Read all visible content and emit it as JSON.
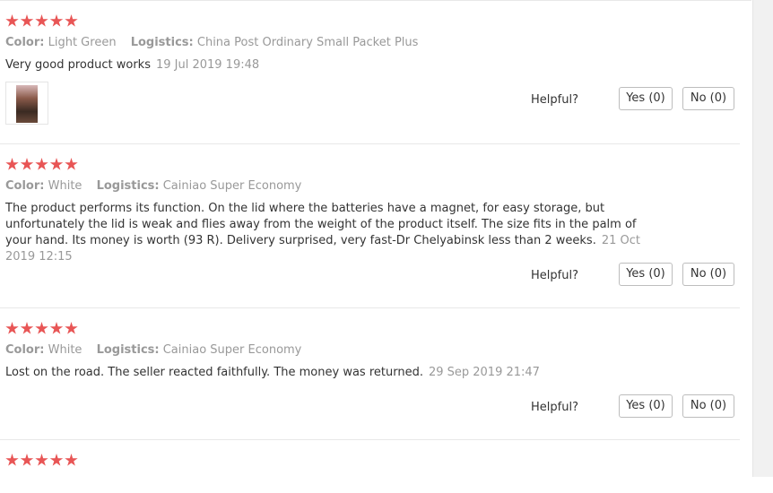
{
  "reviews": [
    {
      "color_label": "Color:",
      "color_value": "Light Green",
      "logistics_label": "Logistics:",
      "logistics_value": "China Post Ordinary Small Packet Plus",
      "text": "Very good product works",
      "date": "19 Jul 2019 19:48",
      "has_photo": true,
      "helpful_label": "Helpful?",
      "yes_label": "Yes (0)",
      "no_label": "No (0)"
    },
    {
      "color_label": "Color:",
      "color_value": "White",
      "logistics_label": "Logistics:",
      "logistics_value": "Cainiao Super Economy",
      "text": "The product performs its function. On the lid where the batteries have a magnet, for easy storage, but unfortunately the lid is weak and flies away from the weight of the product itself. The size fits in the palm of your hand. Its money is worth (93 R). Delivery surprised, very fast-Dr Chelyabinsk less than 2 weeks.",
      "date": "21 Oct 2019 12:15",
      "has_photo": false,
      "helpful_label": "Helpful?",
      "yes_label": "Yes (0)",
      "no_label": "No (0)"
    },
    {
      "color_label": "Color:",
      "color_value": "White",
      "logistics_label": "Logistics:",
      "logistics_value": "Cainiao Super Economy",
      "text": "Lost on the road. The seller reacted faithfully. The money was returned.",
      "date": "29 Sep 2019 21:47",
      "has_photo": false,
      "helpful_label": "Helpful?",
      "yes_label": "Yes (0)",
      "no_label": "No (0)"
    }
  ],
  "rating_stars": 5,
  "star_color": "#e85555"
}
